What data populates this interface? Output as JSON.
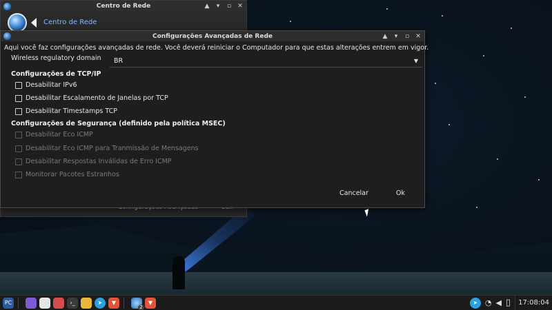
{
  "bg_window": {
    "title": "Centro de Rede",
    "header_label": "Centro de Rede",
    "footer_text": "Configurações Avançadas",
    "footer_text2": "Sair"
  },
  "dialog": {
    "title": "Configurações Avançadas de Rede",
    "intro": "Aqui você faz configurações avançadas de rede. Você deverá reiniciar o Computador para que estas alterações entrem em vigor.",
    "regulatory_label": "Wireless regulatory domain",
    "regulatory_value": "BR",
    "tcp_section": "Configurações de TCP/IP",
    "tcp_options": [
      {
        "label": "Desabilitar IPv6",
        "checked": false
      },
      {
        "label": "Desabilitar Escalamento de Janelas por TCP",
        "checked": false
      },
      {
        "label": "Desabilitar Timestamps TCP",
        "checked": false
      }
    ],
    "security_section": "Configurações de Segurança (definido pela política MSEC)",
    "security_options": [
      {
        "label": "Desabilitar Eco ICMP",
        "checked": false,
        "enabled": false
      },
      {
        "label": "Desabilitar Eco ICMP para Tranmissão de Mensagens",
        "checked": false,
        "enabled": false
      },
      {
        "label": "Desabilitar Respostas Inválidas de Erro ICMP",
        "checked": false,
        "enabled": false
      },
      {
        "label": "Monitorar Pacotes Estranhos",
        "checked": false,
        "enabled": false
      }
    ],
    "cancel_label": "Cancelar",
    "ok_label": "Ok"
  },
  "taskbar": {
    "clock": "17:08:04",
    "badge_count": "2"
  },
  "colors": {
    "accent_link": "#8ab8ff",
    "dialog_bg": "#1e1e1e",
    "taskbar_bg": "#1b1b1b"
  }
}
